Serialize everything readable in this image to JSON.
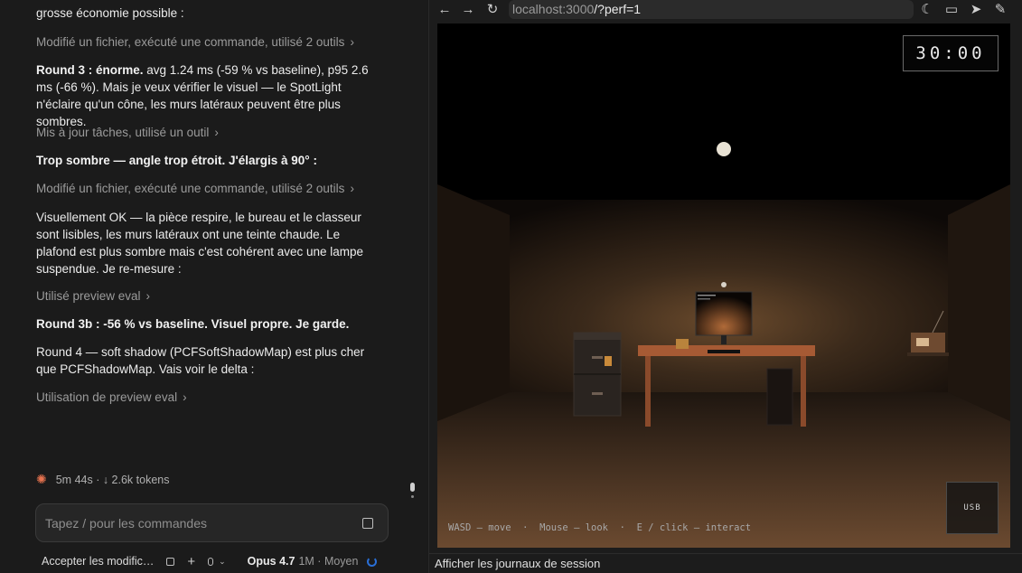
{
  "chat": {
    "top_partial": "grosse économie possible :",
    "tool1": "Modifié un fichier, exécuté une commande, utilisé 2 outils",
    "msg1_bold": "Round 3 : énorme.",
    "msg1_rest": "avg 1.24 ms (-59 % vs baseline), p95 2.6 ms (-66 %). Mais je veux vérifier le visuel — le SpotLight n'éclaire qu'un cône, les murs latéraux peuvent être plus sombres.",
    "tool2": "Mis à jour tâches, utilisé un outil",
    "msg2": "Trop sombre — angle trop étroit. J'élargis à 90° :",
    "tool3": "Modifié un fichier, exécuté une commande, utilisé 2 outils",
    "msg3": "Visuellement OK — la pièce respire, le bureau et le classeur sont lisibles, les murs latéraux ont une teinte chaude. Le plafond est plus sombre mais c'est cohérent avec une lampe suspendue. Je re-mesure :",
    "tool4": "Utilisé preview eval",
    "msg4_bold": "Round 3b : -56 %",
    "msg4_rest": "vs baseline. Visuel propre. Je garde.",
    "msg5": "Round 4 — soft shadow (PCFSoftShadowMap) est plus cher que PCFShadowMap. Vais voir le delta :",
    "tool5": "Utilisation de preview eval",
    "chevron": "›",
    "status": "5m 44s · ↓ 2.6k tokens",
    "status_icon": "✺",
    "composer_placeholder": "Tapez / pour les commandes",
    "footer": {
      "accept": "Accepter les modific…",
      "plus": "+",
      "chev": "⌄",
      "model": "Opus 4.7",
      "model_extra": "1M · Moyen"
    }
  },
  "browser": {
    "url_host": "localhost:3000",
    "url_path": "/?perf=1",
    "icons": {
      "back": "←",
      "forward": "→",
      "reload": "↻",
      "moon": "☾",
      "device": "▭",
      "pointer": "➤",
      "pen": "✎"
    },
    "game": {
      "timer": "30:00",
      "usb_label": "USB",
      "hint": "WASD — move  ·  Mouse — look  ·  E / click — interact"
    },
    "logs_label": "Afficher les journaux de session"
  },
  "colors": {
    "accent_spark": "#e8734f",
    "spinner": "#2a6fd6",
    "desk": "#a65a34",
    "lamp_glow": "#8a5a32"
  }
}
